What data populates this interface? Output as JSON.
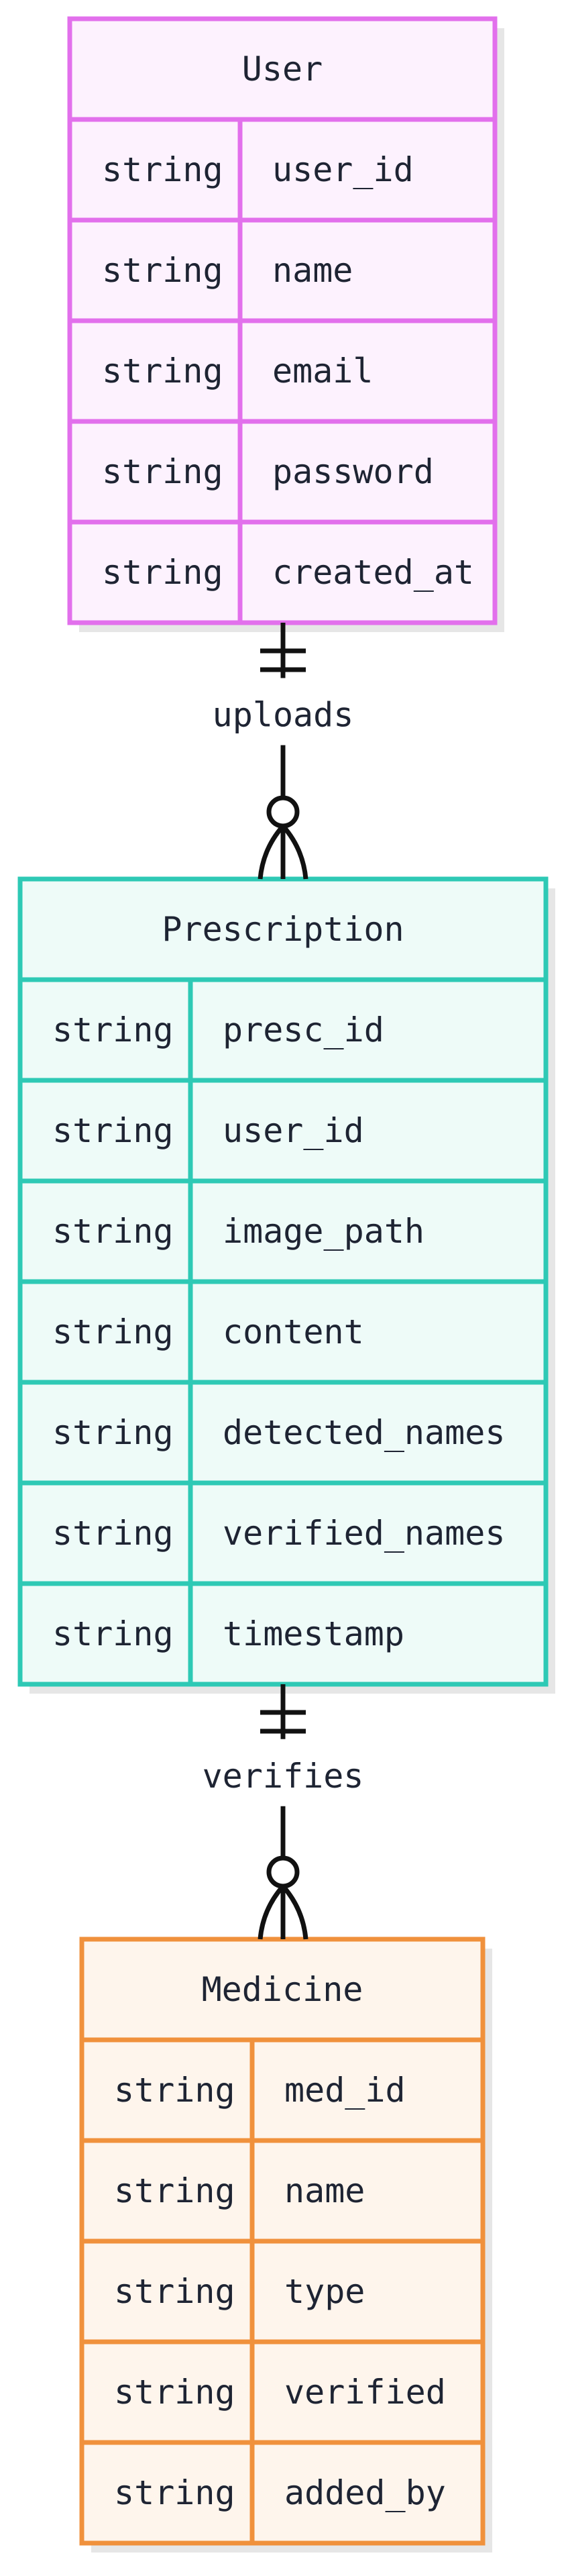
{
  "entities": [
    {
      "name": "User",
      "colors": {
        "border": "#e270ec",
        "fill": "#fdf2fe"
      },
      "attributes": [
        {
          "type": "string",
          "name": "user_id"
        },
        {
          "type": "string",
          "name": "name"
        },
        {
          "type": "string",
          "name": "email"
        },
        {
          "type": "string",
          "name": "password"
        },
        {
          "type": "string",
          "name": "created_at"
        }
      ]
    },
    {
      "name": "Prescription",
      "colors": {
        "border": "#2ec9b5",
        "fill": "#eefbf8"
      },
      "attributes": [
        {
          "type": "string",
          "name": "presc_id"
        },
        {
          "type": "string",
          "name": "user_id"
        },
        {
          "type": "string",
          "name": "image_path"
        },
        {
          "type": "string",
          "name": "content"
        },
        {
          "type": "string",
          "name": "detected_names"
        },
        {
          "type": "string",
          "name": "verified_names"
        },
        {
          "type": "string",
          "name": "timestamp"
        }
      ]
    },
    {
      "name": "Medicine",
      "colors": {
        "border": "#f0913c",
        "fill": "#fef5ec"
      },
      "attributes": [
        {
          "type": "string",
          "name": "med_id"
        },
        {
          "type": "string",
          "name": "name"
        },
        {
          "type": "string",
          "name": "type"
        },
        {
          "type": "string",
          "name": "verified"
        },
        {
          "type": "string",
          "name": "added_by"
        }
      ]
    }
  ],
  "relationships": [
    {
      "label": "uploads",
      "from": "User",
      "to": "Prescription",
      "from_cardinality": "exactly-one",
      "to_cardinality": "zero-or-many"
    },
    {
      "label": "verifies",
      "from": "Prescription",
      "to": "Medicine",
      "from_cardinality": "exactly-one",
      "to_cardinality": "zero-or-many"
    }
  ],
  "colors": {
    "line": "#111111",
    "text": "#1e2433",
    "shadow": "#e6e6e6"
  }
}
